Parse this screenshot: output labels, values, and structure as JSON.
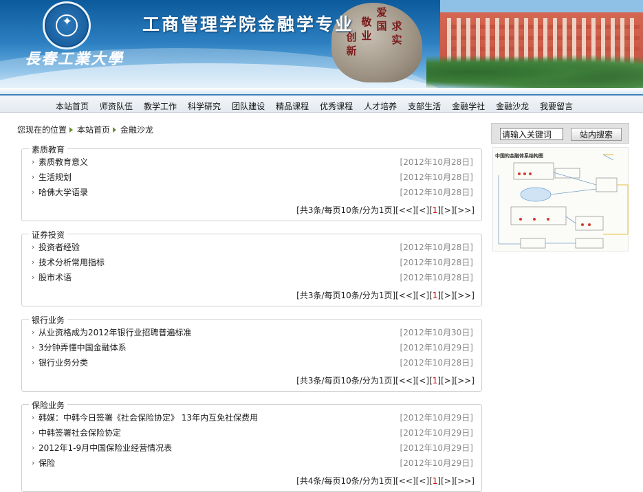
{
  "banner": {
    "site_title": "工商管理学院金融学专业",
    "university_name": "長春工業大學",
    "rock_inscription": [
      "爱国",
      "敬业",
      "求实",
      "创新"
    ]
  },
  "nav": {
    "items": [
      "本站首页",
      "师资队伍",
      "教学工作",
      "科学研究",
      "团队建设",
      "精品课程",
      "优秀课程",
      "人才培养",
      "支部生活",
      "金融学社",
      "金融沙龙",
      "我要留言"
    ]
  },
  "breadcrumb": {
    "prefix": "您现在的位置",
    "items": [
      "本站首页",
      "金融沙龙"
    ]
  },
  "search": {
    "value": "请输入关键词",
    "button_label": "站内搜索"
  },
  "diagram": {
    "title": "中国的金融体系结构图"
  },
  "sections": [
    {
      "title": "素质教育",
      "items": [
        {
          "title": "素质教育意义",
          "date": "[2012年10月28日]"
        },
        {
          "title": "生活规划",
          "date": "[2012年10月28日]"
        },
        {
          "title": "哈佛大学语录",
          "date": "[2012年10月28日]"
        }
      ],
      "pager": {
        "info": "[共3条/每页10条/分为1页]",
        "first": "[<<]",
        "prev": "[<]",
        "current": "1",
        "next": "[>]",
        "last": "[>>]"
      }
    },
    {
      "title": "证券投资",
      "items": [
        {
          "title": "投资者经验",
          "date": "[2012年10月28日]"
        },
        {
          "title": "技术分析常用指标",
          "date": "[2012年10月28日]"
        },
        {
          "title": "股市术语",
          "date": "[2012年10月28日]"
        }
      ],
      "pager": {
        "info": "[共3条/每页10条/分为1页]",
        "first": "[<<]",
        "prev": "[<]",
        "current": "1",
        "next": "[>]",
        "last": "[>>]"
      }
    },
    {
      "title": "银行业务",
      "items": [
        {
          "title": "从业资格成为2012年银行业招聘普遍标准",
          "date": "[2012年10月30日]"
        },
        {
          "title": "3分钟弄懂中国金融体系",
          "date": "[2012年10月29日]"
        },
        {
          "title": "银行业务分类",
          "date": "[2012年10月28日]"
        }
      ],
      "pager": {
        "info": "[共3条/每页10条/分为1页]",
        "first": "[<<]",
        "prev": "[<]",
        "current": "1",
        "next": "[>]",
        "last": "[>>]"
      }
    },
    {
      "title": "保险业务",
      "items": [
        {
          "title": "韩媒：中韩今日签署《社会保险协定》 13年内互免社保费用",
          "date": "[2012年10月29日]"
        },
        {
          "title": "中韩签署社会保险协定",
          "date": "[2012年10月29日]"
        },
        {
          "title": "2012年1-9月中国保险业经营情况表",
          "date": "[2012年10月29日]"
        },
        {
          "title": "保险",
          "date": "[2012年10月29日]"
        }
      ],
      "pager": {
        "info": "[共4条/每页10条/分为1页]",
        "first": "[<<]",
        "prev": "[<]",
        "current": "1",
        "next": "[>]",
        "last": "[>>]"
      }
    }
  ]
}
